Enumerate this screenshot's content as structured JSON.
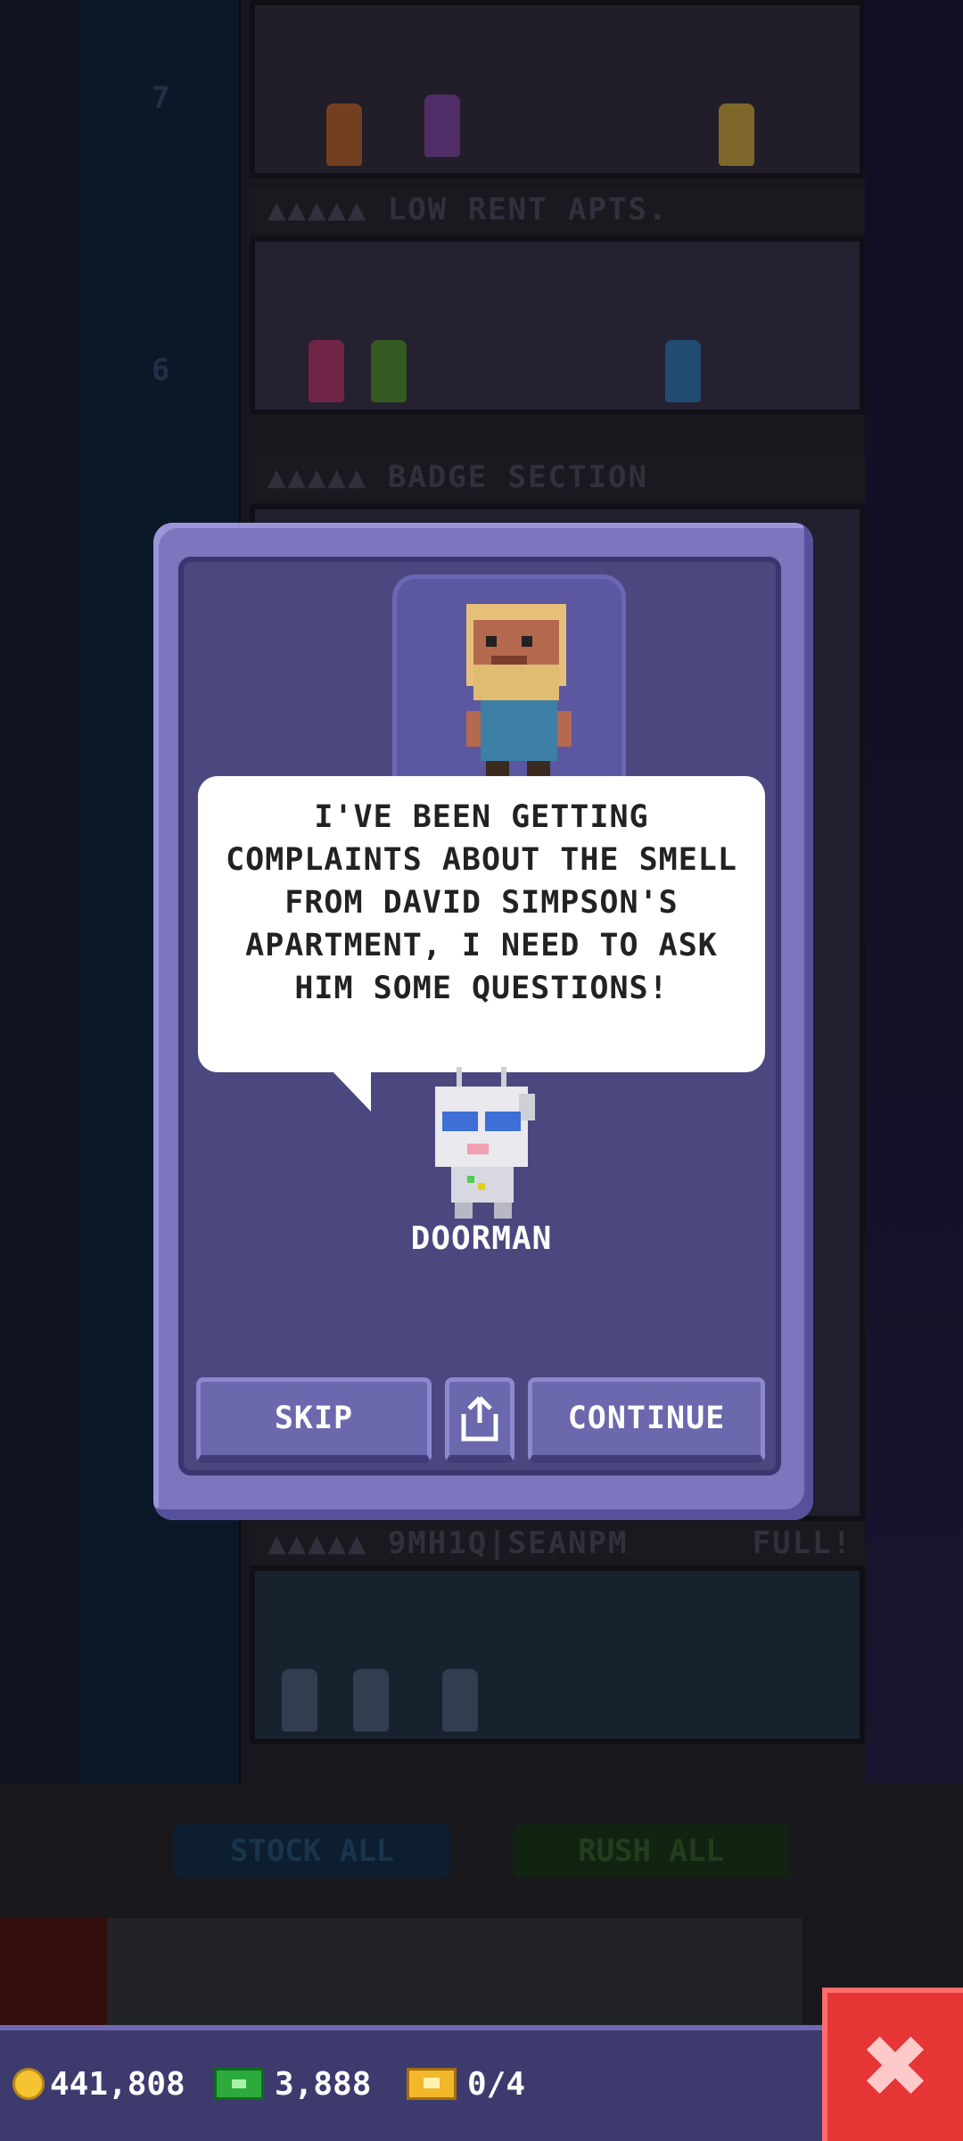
{
  "tower": {
    "floors": [
      {
        "number": "7",
        "label": "LOW RENT APTS."
      },
      {
        "number": "6",
        "label": "BADGE SECTION"
      },
      {
        "number": "",
        "label": "9MH1Q|SEANPM",
        "status": "FULL!"
      }
    ]
  },
  "actions": {
    "stock_all": "STOCK ALL",
    "rush_all": "RUSH ALL"
  },
  "dialog": {
    "message": "I'VE BEEN GETTING COMPLAINTS ABOUT THE SMELL FROM DAVID SIMPSON'S APARTMENT, I NEED TO ASK HIM SOME QUESTIONS!",
    "speaker": "DOORMAN",
    "skip_label": "SKIP",
    "share_icon": "share-icon",
    "continue_label": "CONTINUE"
  },
  "status_bar": {
    "coins": "441,808",
    "bux": "3,888",
    "tickets": "0/4"
  },
  "colors": {
    "dialog_frame": "#7c76bf",
    "dialog_inner": "#4b4880",
    "close_button": "#e53535",
    "status_bar": "#3d3a6e"
  }
}
